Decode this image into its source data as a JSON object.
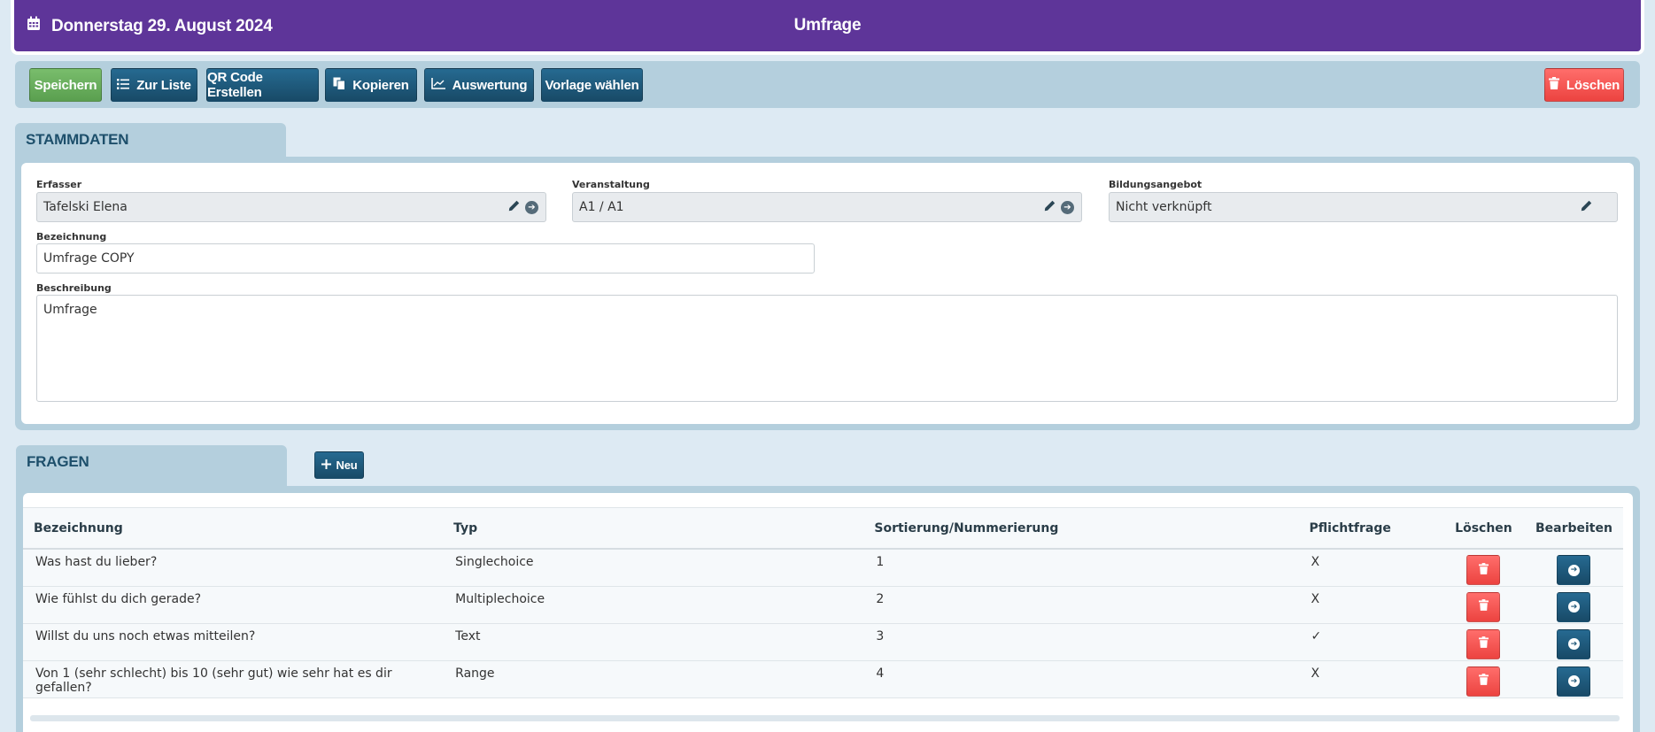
{
  "header": {
    "date": "Donnerstag 29. August 2024",
    "title": "Umfrage"
  },
  "toolbar": {
    "save": "Speichern",
    "list": "Zur Liste",
    "qr": "QR Code Erstellen",
    "copy": "Kopieren",
    "evaluation": "Auswertung",
    "template": "Vorlage wählen",
    "delete": "Löschen"
  },
  "stammdaten": {
    "tab": "STAMMDATEN",
    "erfasser_label": "Erfasser",
    "erfasser_value": "Tafelski Elena",
    "veranstaltung_label": "Veranstaltung",
    "veranstaltung_value": "A1 / A1",
    "bildungsangebot_label": "Bildungsangebot",
    "bildungsangebot_value": "Nicht verknüpft",
    "bezeichnung_label": "Bezeichnung",
    "bezeichnung_value": "Umfrage COPY",
    "beschreibung_label": "Beschreibung",
    "beschreibung_value": "Umfrage"
  },
  "fragen": {
    "tab": "FRAGEN",
    "new_button": "Neu",
    "columns": {
      "bezeichnung": "Bezeichnung",
      "typ": "Typ",
      "sortierung": "Sortierung/Nummerierung",
      "pflicht": "Pflichtfrage",
      "loeschen": "Löschen",
      "bearbeiten": "Bearbeiten"
    },
    "rows": [
      {
        "bezeichnung": "Was hast du lieber?",
        "typ": "Singlechoice",
        "sortierung": "1",
        "pflicht": "X"
      },
      {
        "bezeichnung": "Wie fühlst du dich gerade?",
        "typ": "Multiplechoice",
        "sortierung": "2",
        "pflicht": "X"
      },
      {
        "bezeichnung": "Willst du uns noch etwas mitteilen?",
        "typ": "Text",
        "sortierung": "3",
        "pflicht": "✓"
      },
      {
        "bezeichnung": "Von 1 (sehr schlecht) bis 10 (sehr gut) wie sehr hat es dir gefallen?",
        "typ": "Range",
        "sortierung": "4",
        "pflicht": "X"
      }
    ]
  },
  "icons": {
    "calendar": "calendar-icon",
    "list": "list-icon",
    "copy": "copy-icon",
    "chart": "chart-icon",
    "trash": "trash-icon",
    "pencil": "pencil-icon",
    "arrow": "arrow-right-circle-icon",
    "plus": "plus-icon"
  },
  "colors": {
    "header": "#5e3599",
    "primary_button": "#1d5677",
    "save_button": "#6aaf5d",
    "delete_button": "#f5504d",
    "panel": "#b4cfdd",
    "background": "#ddeaf3"
  }
}
